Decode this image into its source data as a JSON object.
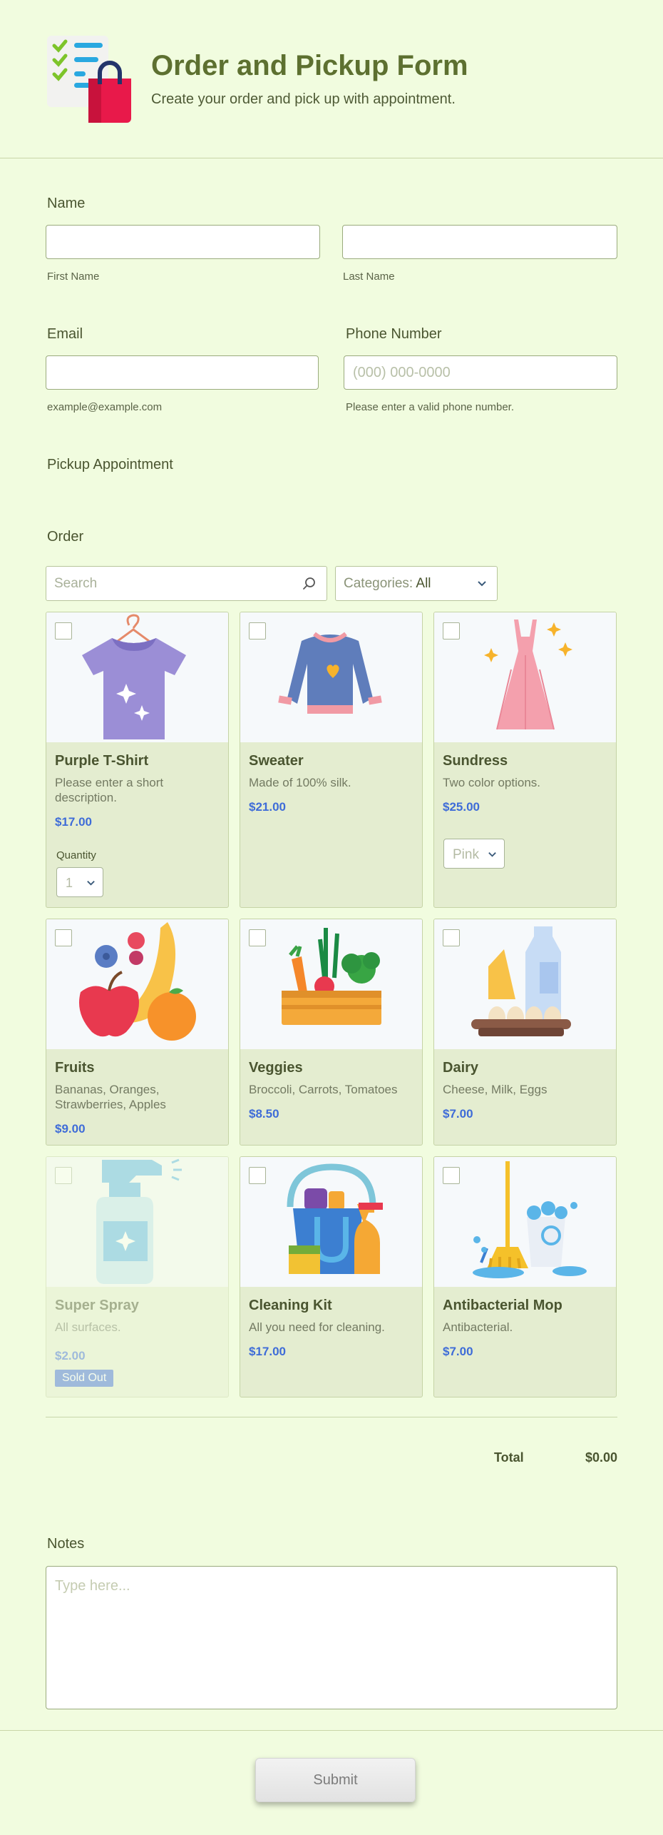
{
  "header": {
    "title": "Order and Pickup Form",
    "subtitle": "Create your order and pick up with appointment."
  },
  "name_section": {
    "label": "Name",
    "first_sublabel": "First Name",
    "last_sublabel": "Last Name",
    "first_value": "",
    "last_value": ""
  },
  "email_section": {
    "label": "Email",
    "value": "",
    "sublabel": "example@example.com"
  },
  "phone_section": {
    "label": "Phone Number",
    "placeholder": "(000) 000-0000",
    "sublabel": "Please enter a valid phone number."
  },
  "pickup": {
    "label": "Pickup Appointment"
  },
  "order": {
    "label": "Order",
    "search_placeholder": "Search",
    "categories_key": "Categories:",
    "categories_value": "All",
    "quantity_label": "Quantity",
    "quantity_value": "1",
    "color_value": "Pink",
    "sold_out_label": "Sold Out",
    "products": [
      {
        "name": "Purple T-Shirt",
        "desc": "Please enter a short description.",
        "price": "$17.00",
        "icon": "tshirt-icon"
      },
      {
        "name": "Sweater",
        "desc": "Made of 100% silk.",
        "price": "$21.00",
        "icon": "sweater-icon"
      },
      {
        "name": "Sundress",
        "desc": "Two color options.",
        "price": "$25.00",
        "icon": "dress-icon"
      },
      {
        "name": "Fruits",
        "desc": "Bananas, Oranges, Strawberries, Apples",
        "price": "$9.00",
        "icon": "fruits-icon"
      },
      {
        "name": "Veggies",
        "desc": "Broccoli, Carrots, Tomatoes",
        "price": "$8.50",
        "icon": "veggies-icon"
      },
      {
        "name": "Dairy",
        "desc": "Cheese, Milk, Eggs",
        "price": "$7.00",
        "icon": "dairy-icon"
      },
      {
        "name": "Super Spray",
        "desc": "All surfaces.",
        "price": "$2.00",
        "icon": "spray-icon"
      },
      {
        "name": "Cleaning Kit",
        "desc": "All you need for cleaning.",
        "price": "$17.00",
        "icon": "cleaning-kit-icon"
      },
      {
        "name": "Antibacterial Mop",
        "desc": "Antibacterial.",
        "price": "$7.00",
        "icon": "mop-icon"
      }
    ],
    "total_label": "Total",
    "total_value": "$0.00"
  },
  "notes": {
    "label": "Notes",
    "placeholder": "Type here..."
  },
  "submit_label": "Submit",
  "colors": {
    "background": "#f1fcdf",
    "title": "#5d7030",
    "price": "#3e6cd8",
    "card_bg": "#e4edd0"
  }
}
